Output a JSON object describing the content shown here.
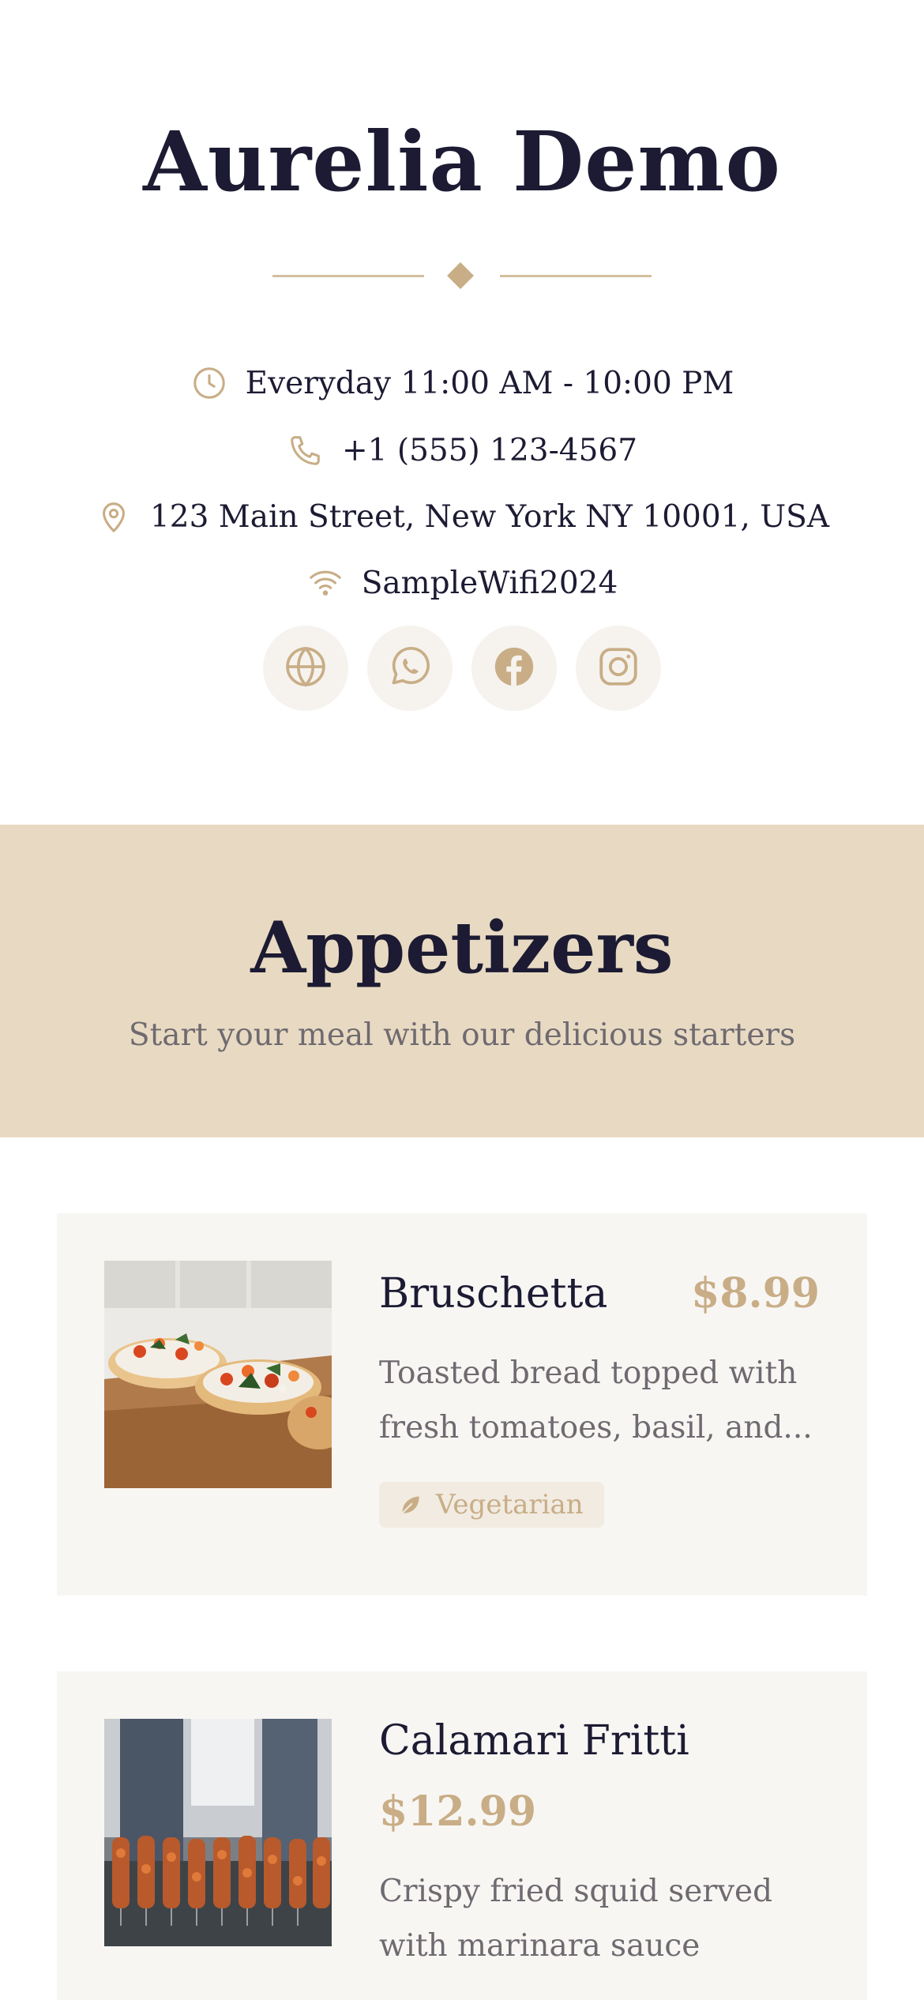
{
  "restaurant": {
    "name": "Aurelia Demo"
  },
  "info": {
    "hours": "Everyday 11:00 AM - 10:00 PM",
    "phone": "+1 (555) 123-4567",
    "address": "123 Main Street, New York NY 10001, USA",
    "wifi": "SampleWifi2024"
  },
  "socials": [
    {
      "name": "website",
      "icon": "globe-icon"
    },
    {
      "name": "whatsapp",
      "icon": "whatsapp-icon"
    },
    {
      "name": "facebook",
      "icon": "facebook-icon"
    },
    {
      "name": "instagram",
      "icon": "instagram-icon"
    }
  ],
  "colors": {
    "text": "#1c1b33",
    "accent": "#c8ad86",
    "band": "#e8dac2",
    "card": "#f8f6f3",
    "muted": "#6f6a70"
  },
  "category": {
    "title": "Appetizers",
    "subtitle": "Start your meal with our delicious starters"
  },
  "items": [
    {
      "name": "Bruschetta",
      "price": "$8.99",
      "description": "Toasted bread topped with fresh tomatoes, basil, and...",
      "tag": "Vegetarian",
      "tag_icon": "leaf-icon"
    },
    {
      "name": "Calamari Fritti",
      "price": "$12.99",
      "description": "Crispy fried squid served with marinara sauce"
    }
  ]
}
